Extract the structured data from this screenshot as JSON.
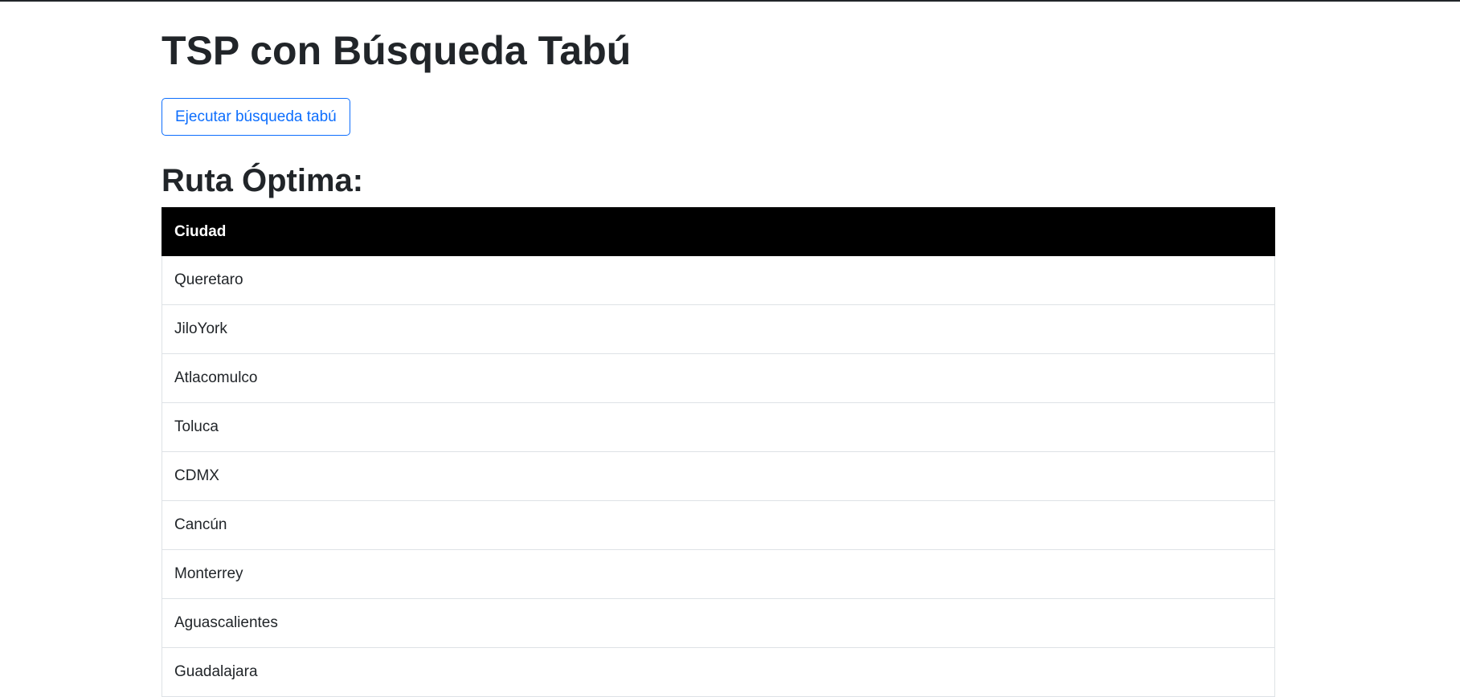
{
  "page": {
    "title": "TSP con Búsqueda Tabú",
    "run_button_label": "Ejecutar búsqueda tabú",
    "section_title": "Ruta Óptima:"
  },
  "table": {
    "header": "Ciudad",
    "rows": [
      "Queretaro",
      "JiloYork",
      "Atlacomulco",
      "Toluca",
      "CDMX",
      "Cancún",
      "Monterrey",
      "Aguascalientes",
      "Guadalajara"
    ]
  },
  "colors": {
    "accent": "#0d6efd",
    "header_bg": "#000000",
    "text": "#212529",
    "border": "#dee2e6"
  }
}
